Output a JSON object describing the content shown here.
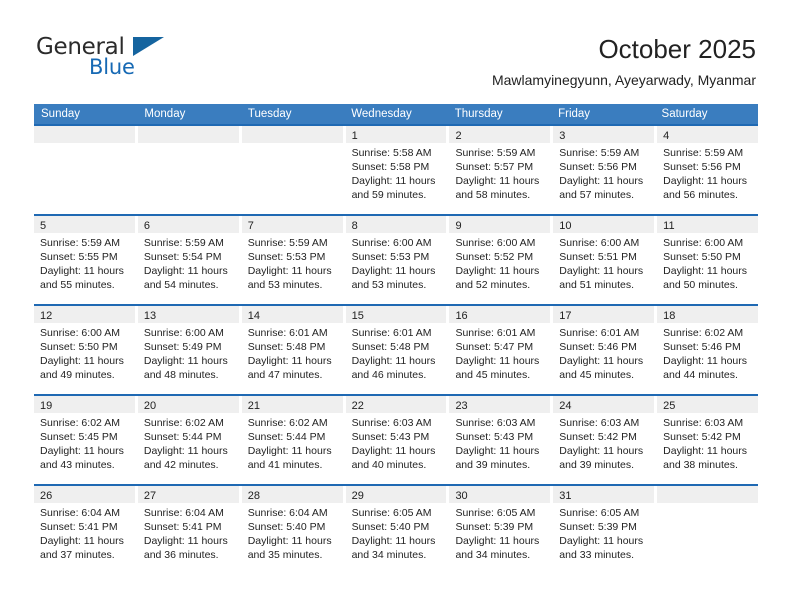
{
  "brand": {
    "name_part1": "General",
    "name_part2": "Blue",
    "logo_icon": "blue-triangle-mark"
  },
  "header": {
    "month_title": "October 2025",
    "location": "Mawlamyinegyunn, Ayeyarwady, Myanmar"
  },
  "colors": {
    "header_blue": "#3a7dbf",
    "row_divider_blue": "#1f69b3",
    "day_strip_gray": "#efefef",
    "brand_blue": "#1669b4"
  },
  "calendar": {
    "weekday_headers": [
      "Sunday",
      "Monday",
      "Tuesday",
      "Wednesday",
      "Thursday",
      "Friday",
      "Saturday"
    ],
    "weeks": [
      [
        {
          "day": "",
          "sunrise": "",
          "sunset": "",
          "daylight_line1": "",
          "daylight_line2": "",
          "empty": true
        },
        {
          "day": "",
          "sunrise": "",
          "sunset": "",
          "daylight_line1": "",
          "daylight_line2": "",
          "empty": true
        },
        {
          "day": "",
          "sunrise": "",
          "sunset": "",
          "daylight_line1": "",
          "daylight_line2": "",
          "empty": true
        },
        {
          "day": "1",
          "sunrise": "Sunrise: 5:58 AM",
          "sunset": "Sunset: 5:58 PM",
          "daylight_line1": "Daylight: 11 hours",
          "daylight_line2": "and 59 minutes.",
          "empty": false
        },
        {
          "day": "2",
          "sunrise": "Sunrise: 5:59 AM",
          "sunset": "Sunset: 5:57 PM",
          "daylight_line1": "Daylight: 11 hours",
          "daylight_line2": "and 58 minutes.",
          "empty": false
        },
        {
          "day": "3",
          "sunrise": "Sunrise: 5:59 AM",
          "sunset": "Sunset: 5:56 PM",
          "daylight_line1": "Daylight: 11 hours",
          "daylight_line2": "and 57 minutes.",
          "empty": false
        },
        {
          "day": "4",
          "sunrise": "Sunrise: 5:59 AM",
          "sunset": "Sunset: 5:56 PM",
          "daylight_line1": "Daylight: 11 hours",
          "daylight_line2": "and 56 minutes.",
          "empty": false
        }
      ],
      [
        {
          "day": "5",
          "sunrise": "Sunrise: 5:59 AM",
          "sunset": "Sunset: 5:55 PM",
          "daylight_line1": "Daylight: 11 hours",
          "daylight_line2": "and 55 minutes.",
          "empty": false
        },
        {
          "day": "6",
          "sunrise": "Sunrise: 5:59 AM",
          "sunset": "Sunset: 5:54 PM",
          "daylight_line1": "Daylight: 11 hours",
          "daylight_line2": "and 54 minutes.",
          "empty": false
        },
        {
          "day": "7",
          "sunrise": "Sunrise: 5:59 AM",
          "sunset": "Sunset: 5:53 PM",
          "daylight_line1": "Daylight: 11 hours",
          "daylight_line2": "and 53 minutes.",
          "empty": false
        },
        {
          "day": "8",
          "sunrise": "Sunrise: 6:00 AM",
          "sunset": "Sunset: 5:53 PM",
          "daylight_line1": "Daylight: 11 hours",
          "daylight_line2": "and 53 minutes.",
          "empty": false
        },
        {
          "day": "9",
          "sunrise": "Sunrise: 6:00 AM",
          "sunset": "Sunset: 5:52 PM",
          "daylight_line1": "Daylight: 11 hours",
          "daylight_line2": "and 52 minutes.",
          "empty": false
        },
        {
          "day": "10",
          "sunrise": "Sunrise: 6:00 AM",
          "sunset": "Sunset: 5:51 PM",
          "daylight_line1": "Daylight: 11 hours",
          "daylight_line2": "and 51 minutes.",
          "empty": false
        },
        {
          "day": "11",
          "sunrise": "Sunrise: 6:00 AM",
          "sunset": "Sunset: 5:50 PM",
          "daylight_line1": "Daylight: 11 hours",
          "daylight_line2": "and 50 minutes.",
          "empty": false
        }
      ],
      [
        {
          "day": "12",
          "sunrise": "Sunrise: 6:00 AM",
          "sunset": "Sunset: 5:50 PM",
          "daylight_line1": "Daylight: 11 hours",
          "daylight_line2": "and 49 minutes.",
          "empty": false
        },
        {
          "day": "13",
          "sunrise": "Sunrise: 6:00 AM",
          "sunset": "Sunset: 5:49 PM",
          "daylight_line1": "Daylight: 11 hours",
          "daylight_line2": "and 48 minutes.",
          "empty": false
        },
        {
          "day": "14",
          "sunrise": "Sunrise: 6:01 AM",
          "sunset": "Sunset: 5:48 PM",
          "daylight_line1": "Daylight: 11 hours",
          "daylight_line2": "and 47 minutes.",
          "empty": false
        },
        {
          "day": "15",
          "sunrise": "Sunrise: 6:01 AM",
          "sunset": "Sunset: 5:48 PM",
          "daylight_line1": "Daylight: 11 hours",
          "daylight_line2": "and 46 minutes.",
          "empty": false
        },
        {
          "day": "16",
          "sunrise": "Sunrise: 6:01 AM",
          "sunset": "Sunset: 5:47 PM",
          "daylight_line1": "Daylight: 11 hours",
          "daylight_line2": "and 45 minutes.",
          "empty": false
        },
        {
          "day": "17",
          "sunrise": "Sunrise: 6:01 AM",
          "sunset": "Sunset: 5:46 PM",
          "daylight_line1": "Daylight: 11 hours",
          "daylight_line2": "and 45 minutes.",
          "empty": false
        },
        {
          "day": "18",
          "sunrise": "Sunrise: 6:02 AM",
          "sunset": "Sunset: 5:46 PM",
          "daylight_line1": "Daylight: 11 hours",
          "daylight_line2": "and 44 minutes.",
          "empty": false
        }
      ],
      [
        {
          "day": "19",
          "sunrise": "Sunrise: 6:02 AM",
          "sunset": "Sunset: 5:45 PM",
          "daylight_line1": "Daylight: 11 hours",
          "daylight_line2": "and 43 minutes.",
          "empty": false
        },
        {
          "day": "20",
          "sunrise": "Sunrise: 6:02 AM",
          "sunset": "Sunset: 5:44 PM",
          "daylight_line1": "Daylight: 11 hours",
          "daylight_line2": "and 42 minutes.",
          "empty": false
        },
        {
          "day": "21",
          "sunrise": "Sunrise: 6:02 AM",
          "sunset": "Sunset: 5:44 PM",
          "daylight_line1": "Daylight: 11 hours",
          "daylight_line2": "and 41 minutes.",
          "empty": false
        },
        {
          "day": "22",
          "sunrise": "Sunrise: 6:03 AM",
          "sunset": "Sunset: 5:43 PM",
          "daylight_line1": "Daylight: 11 hours",
          "daylight_line2": "and 40 minutes.",
          "empty": false
        },
        {
          "day": "23",
          "sunrise": "Sunrise: 6:03 AM",
          "sunset": "Sunset: 5:43 PM",
          "daylight_line1": "Daylight: 11 hours",
          "daylight_line2": "and 39 minutes.",
          "empty": false
        },
        {
          "day": "24",
          "sunrise": "Sunrise: 6:03 AM",
          "sunset": "Sunset: 5:42 PM",
          "daylight_line1": "Daylight: 11 hours",
          "daylight_line2": "and 39 minutes.",
          "empty": false
        },
        {
          "day": "25",
          "sunrise": "Sunrise: 6:03 AM",
          "sunset": "Sunset: 5:42 PM",
          "daylight_line1": "Daylight: 11 hours",
          "daylight_line2": "and 38 minutes.",
          "empty": false
        }
      ],
      [
        {
          "day": "26",
          "sunrise": "Sunrise: 6:04 AM",
          "sunset": "Sunset: 5:41 PM",
          "daylight_line1": "Daylight: 11 hours",
          "daylight_line2": "and 37 minutes.",
          "empty": false
        },
        {
          "day": "27",
          "sunrise": "Sunrise: 6:04 AM",
          "sunset": "Sunset: 5:41 PM",
          "daylight_line1": "Daylight: 11 hours",
          "daylight_line2": "and 36 minutes.",
          "empty": false
        },
        {
          "day": "28",
          "sunrise": "Sunrise: 6:04 AM",
          "sunset": "Sunset: 5:40 PM",
          "daylight_line1": "Daylight: 11 hours",
          "daylight_line2": "and 35 minutes.",
          "empty": false
        },
        {
          "day": "29",
          "sunrise": "Sunrise: 6:05 AM",
          "sunset": "Sunset: 5:40 PM",
          "daylight_line1": "Daylight: 11 hours",
          "daylight_line2": "and 34 minutes.",
          "empty": false
        },
        {
          "day": "30",
          "sunrise": "Sunrise: 6:05 AM",
          "sunset": "Sunset: 5:39 PM",
          "daylight_line1": "Daylight: 11 hours",
          "daylight_line2": "and 34 minutes.",
          "empty": false
        },
        {
          "day": "31",
          "sunrise": "Sunrise: 6:05 AM",
          "sunset": "Sunset: 5:39 PM",
          "daylight_line1": "Daylight: 11 hours",
          "daylight_line2": "and 33 minutes.",
          "empty": false
        },
        {
          "day": "",
          "sunrise": "",
          "sunset": "",
          "daylight_line1": "",
          "daylight_line2": "",
          "empty": true
        }
      ]
    ]
  }
}
